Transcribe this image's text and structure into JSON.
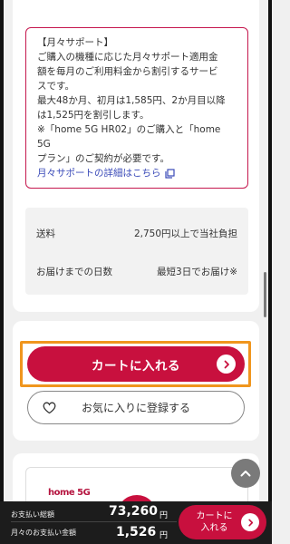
{
  "support": {
    "title": "【月々サポート】",
    "body": "ご購入の機種に応じた月々サポート適用金\n額を毎月のご利用料金から割引するサービ\nスです。\n最大48か月、初月は1,585円、2か月目以降\nは1,525円を割引します。\n※「home 5G HR02」のご購入と「home 5G\nプラン」のご契約が必要です。",
    "link": "月々サポートの詳細はこちら"
  },
  "shipping": {
    "rows": [
      {
        "label": "送料",
        "value": "2,750円以上で当社負担"
      },
      {
        "label": "お届けまでの日数",
        "value": "最短3日でお届け※"
      }
    ]
  },
  "actions": {
    "cart_label": "カートに入れる",
    "favorite_label": "お気に入りに登録する"
  },
  "product": {
    "logo_text": "home 5G"
  },
  "summary": {
    "total_label": "お支払い総額",
    "total_value": "73,260",
    "monthly_label": "月々のお支払い金額",
    "monthly_value": "1,526",
    "yen": "円",
    "cart_label": "カートに\n入れる"
  },
  "colors": {
    "accent": "#c8103e",
    "highlight": "#f0961e",
    "link": "#3a4ab8"
  }
}
